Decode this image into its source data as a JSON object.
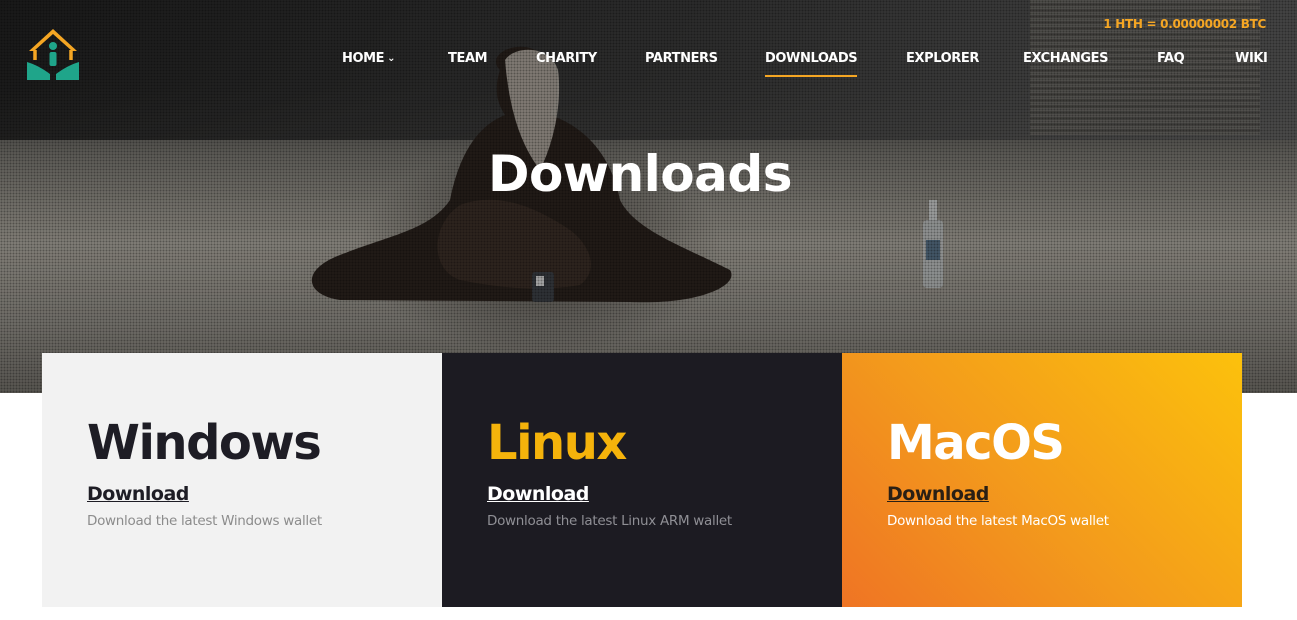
{
  "ticker": {
    "price_text": "1 HTH = 0.00000002 BTC"
  },
  "colors": {
    "accent": "#f5a623",
    "dark": "#1c1b22",
    "light_card": "#f2f2f2",
    "mac_gradient_start": "#ef7424",
    "mac_gradient_end": "#fcc10c",
    "linux_title": "#f5b30b"
  },
  "nav": {
    "items": [
      {
        "label": "HOME",
        "icon": "chevron-down-icon"
      },
      {
        "label": "TEAM"
      },
      {
        "label": "CHARITY"
      },
      {
        "label": "PARTNERS"
      },
      {
        "label": "DOWNLOADS",
        "active": true
      },
      {
        "label": "EXPLORER"
      },
      {
        "label": "EXCHANGES"
      },
      {
        "label": "FAQ"
      },
      {
        "label": "WIKI"
      }
    ]
  },
  "hero": {
    "title": "Downloads",
    "image": "homeless-man-sitting-on-pavement-photo"
  },
  "logo": {
    "icon": "house-with-person-and-hands-logo"
  },
  "cards": [
    {
      "title": "Windows",
      "link": "Download",
      "description": "Download the latest Windows wallet"
    },
    {
      "title": "Linux",
      "link": "Download",
      "description": "Download the latest Linux ARM wallet"
    },
    {
      "title": "MacOS",
      "link": "Download",
      "description": "Download the latest MacOS wallet"
    }
  ]
}
